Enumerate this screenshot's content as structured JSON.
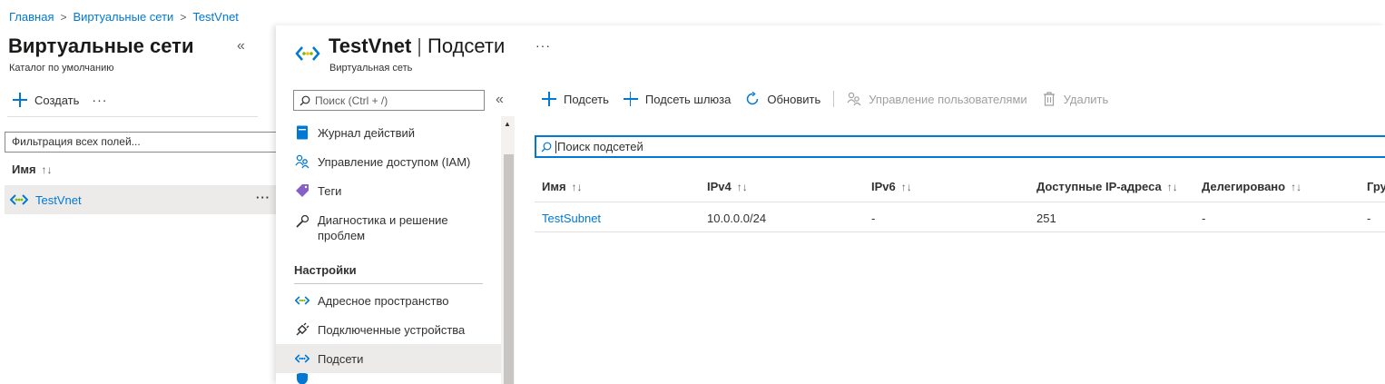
{
  "breadcrumb": [
    "Главная",
    "Виртуальные сети",
    "TestVnet"
  ],
  "left_panel": {
    "title": "Виртуальные сети",
    "subtitle": "Каталог по умолчанию",
    "create_label": "Создать",
    "filter_placeholder": "Фильтрация всех полей...",
    "column_name": "Имя",
    "rows": [
      {
        "name": "TestVnet"
      }
    ]
  },
  "blade": {
    "title_resource": "TestVnet",
    "title_page": "Подсети",
    "subtitle": "Виртуальная сеть"
  },
  "menu": {
    "search_placeholder": "Поиск (Ctrl + /)",
    "items_top": [
      {
        "label": "Журнал действий",
        "icon": "activity-log-icon"
      },
      {
        "label": "Управление доступом (IAM)",
        "icon": "iam-icon"
      },
      {
        "label": "Теги",
        "icon": "tag-icon"
      },
      {
        "label": "Диагностика и решение проблем",
        "icon": "wrench-icon"
      }
    ],
    "section_settings": "Настройки",
    "items_settings": [
      {
        "label": "Адресное пространство",
        "icon": "address-space-icon"
      },
      {
        "label": "Подключенные устройства",
        "icon": "plug-icon"
      },
      {
        "label": "Подсети",
        "icon": "subnet-icon",
        "active": true
      }
    ]
  },
  "toolbar": {
    "add_subnet": "Подсеть",
    "add_gateway_subnet": "Подсеть шлюза",
    "refresh": "Обновить",
    "manage_users": "Управление пользователями",
    "delete": "Удалить"
  },
  "search": {
    "placeholder": "Поиск подсетей"
  },
  "table": {
    "columns": [
      "Имя",
      "IPv4",
      "IPv6",
      "Доступные IP-адреса",
      "Делегировано",
      "Гру"
    ],
    "rows": [
      {
        "name": "TestSubnet",
        "ipv4": "10.0.0.0/24",
        "ipv6": "-",
        "available": "251",
        "delegated": "-",
        "group": "-"
      }
    ]
  },
  "colors": {
    "accent": "#0078d4",
    "selected_bg": "#edebe9",
    "text": "#323130",
    "disabled": "#a19f9d"
  }
}
